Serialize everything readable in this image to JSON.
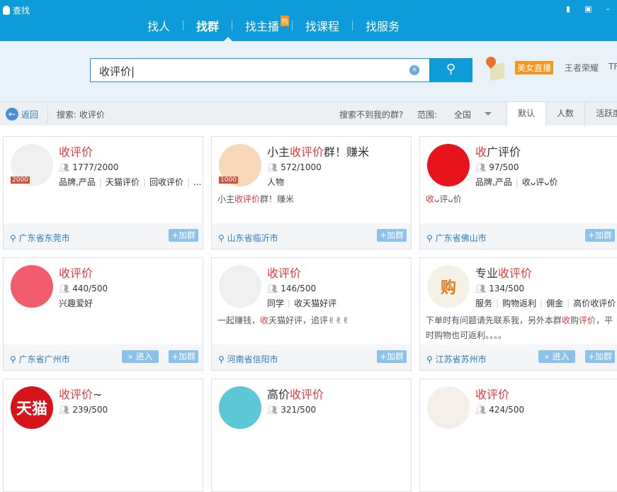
{
  "app": {
    "title": "查找",
    "window_controls": [
      "feedback-icon",
      "lock-icon",
      "minimize-icon",
      "close-icon"
    ]
  },
  "nav": {
    "tabs": [
      {
        "label": "找人"
      },
      {
        "label": "找群",
        "active": true
      },
      {
        "label": "找主播",
        "badge": "热"
      },
      {
        "label": "找课程"
      },
      {
        "label": "找服务"
      }
    ]
  },
  "search": {
    "value": "收评价",
    "hot_tag": "美女直播",
    "tags": [
      "王者荣耀",
      "TF"
    ]
  },
  "toolbar": {
    "back": "返回",
    "search_label": "搜索: 收评价",
    "not_found": "搜索不到我的群?",
    "range_label": "范围:",
    "range_value": "全国",
    "sort": [
      "默认",
      "人数",
      "活跃度"
    ]
  },
  "colors": {
    "brand": "#0e9bd9",
    "highlight": "#e4393c",
    "hot": "#f7941d"
  },
  "cards": [
    {
      "title": [
        {
          "t": "收评价",
          "h": 1
        }
      ],
      "members": "1777/2000",
      "level": "2000",
      "tags": [
        "品牌,产品",
        "天猫评价",
        "回收评价",
        "..."
      ],
      "desc": [],
      "city": "广东省东莞市",
      "enter": false,
      "join": "+加群",
      "avatar": "#f0f0f0"
    },
    {
      "title": [
        {
          "t": "小主",
          "h": 0
        },
        {
          "t": "收评价",
          "h": 1
        },
        {
          "t": "群！赚米",
          "h": 0
        }
      ],
      "members": "572/1000",
      "level": "1000",
      "tags": [
        "人物"
      ],
      "desc": [
        {
          "t": "小主",
          "h": 0
        },
        {
          "t": "收评价",
          "h": 1
        },
        {
          "t": "群！赚米",
          "h": 0
        }
      ],
      "city": "山东省临沂市",
      "enter": false,
      "join": "+加群",
      "avatar": "#f6d8b8"
    },
    {
      "title": [
        {
          "t": "收",
          "h": 1
        },
        {
          "t": "广评价",
          "h": 0
        }
      ],
      "members": "97/500",
      "tags": [
        "品牌,产品",
        "收ᴗ评ᴗ价"
      ],
      "desc": [
        {
          "t": "收",
          "h": 1
        },
        {
          "t": "ᴗ评ᴗ价",
          "h": 0
        }
      ],
      "city": "广东省佛山市",
      "enter": false,
      "join": "+加群",
      "avatar": "#e8141b"
    },
    {
      "title": [
        {
          "t": "收评价",
          "h": 1
        }
      ],
      "members": "440/500",
      "tags": [
        "兴趣爱好"
      ],
      "desc": [],
      "city": "广东省广州市",
      "enter": "» 进入",
      "join": "+加群",
      "avatar": "#f25c6e"
    },
    {
      "title": [
        {
          "t": "收评价",
          "h": 1
        }
      ],
      "members": "146/500",
      "tags": [
        "同学",
        "收天猫好评"
      ],
      "desc": [
        {
          "t": "一起赚钱，",
          "h": 0
        },
        {
          "t": "收",
          "h": 1
        },
        {
          "t": "天猫好评，追评✌✌✌",
          "h": 0
        }
      ],
      "city": "河南省信阳市",
      "enter": false,
      "join": "+加群",
      "avatar": "#f0f0f0"
    },
    {
      "title": [
        {
          "t": "专业",
          "h": 0
        },
        {
          "t": "收评价",
          "h": 1
        }
      ],
      "members": "134/500",
      "tags": [
        "服务",
        "购物返利",
        "佣金",
        "高价收评价"
      ],
      "desc": [
        {
          "t": "下单时有问题请先联系我，另外本群",
          "h": 0
        },
        {
          "t": "收",
          "h": 1
        },
        {
          "t": "购",
          "h": 0
        },
        {
          "t": "评价",
          "h": 1
        },
        {
          "t": "，平时购物也可返利。。。。",
          "h": 0
        }
      ],
      "city": "江苏省苏州市",
      "enter": "» 进入",
      "join": "+加群",
      "avatar": "#f5f1e6",
      "avatar_text": "购"
    },
    {
      "title": [
        {
          "t": "收评价",
          "h": 1
        },
        {
          "t": "~",
          "h": 0
        }
      ],
      "members": "239/500",
      "tags": [],
      "desc": [],
      "city": "",
      "enter": false,
      "join": "",
      "avatar": "#d8141b",
      "avatar_text": "天猫"
    },
    {
      "title": [
        {
          "t": "高价",
          "h": 0
        },
        {
          "t": "收评价",
          "h": 1
        }
      ],
      "members": "321/500",
      "tags": [],
      "desc": [],
      "city": "",
      "enter": false,
      "join": "",
      "avatar": "#5cc8d6"
    },
    {
      "title": [
        {
          "t": "收评价",
          "h": 1
        }
      ],
      "members": "424/500",
      "tags": [],
      "desc": [],
      "city": "",
      "enter": false,
      "join": "",
      "avatar": "#f4efe9"
    }
  ]
}
